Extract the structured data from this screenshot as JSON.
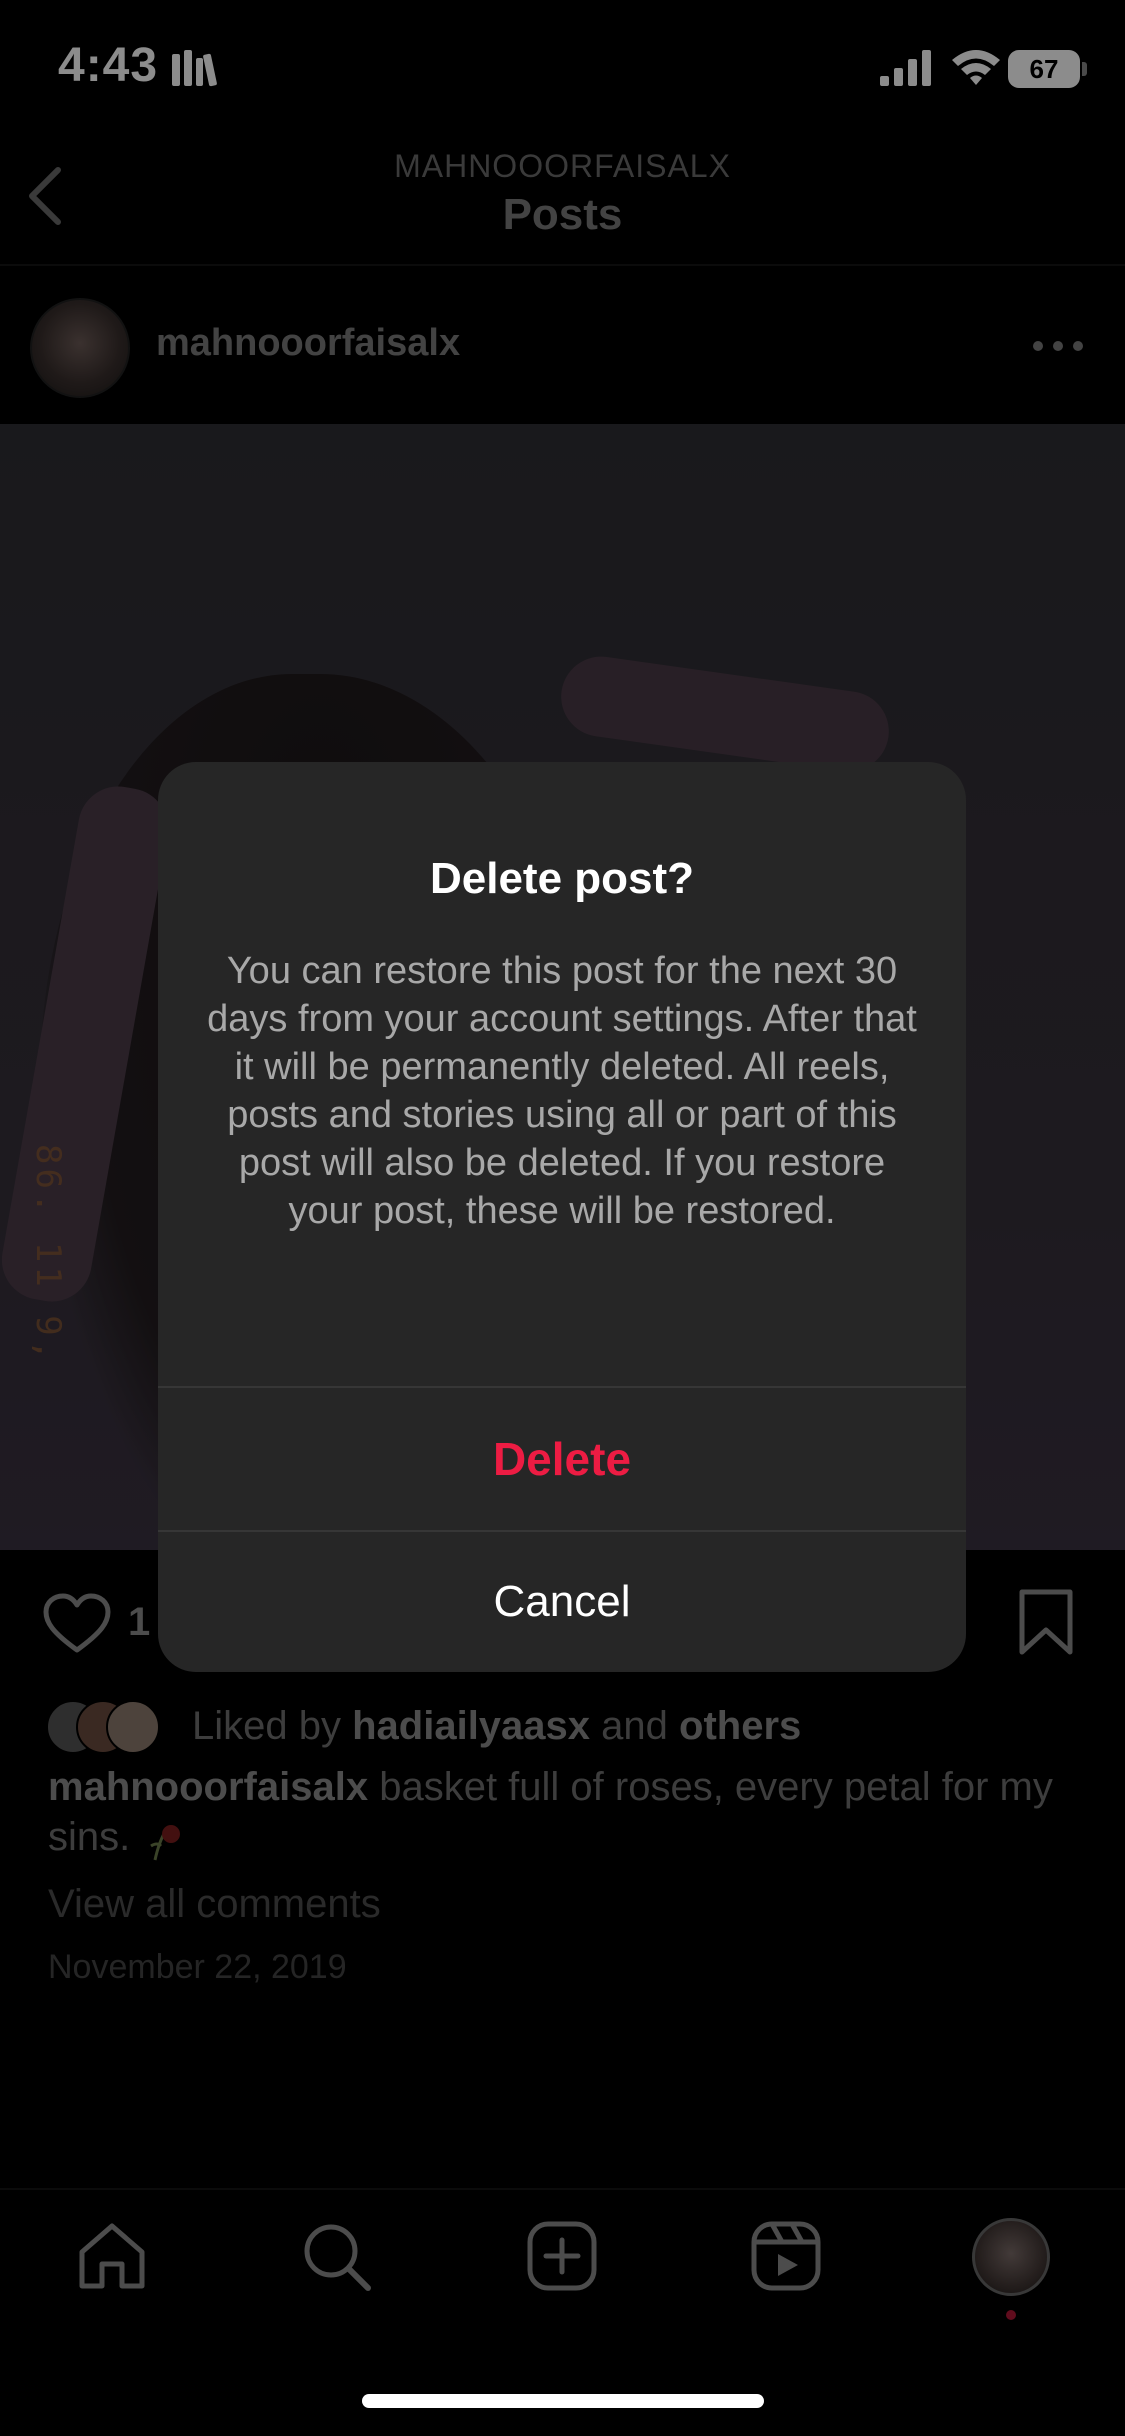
{
  "status_bar": {
    "time": "4:43",
    "battery": "67"
  },
  "header": {
    "subtitle": "MAHNOOORFAISALX",
    "title": "Posts"
  },
  "post": {
    "username": "mahnooorfaisalx",
    "film_stamp": "86. 11 9,",
    "like_count": "1",
    "liked_by_prefix": "Liked by",
    "liked_by_user": "hadiailyaasx",
    "liked_by_and": "and",
    "liked_by_others": "others",
    "caption_user": "mahnooorfaisalx",
    "caption_text": "basket full of roses, every petal for my sins.",
    "view_comments": "View all comments",
    "date": "November 22, 2019"
  },
  "dialog": {
    "title": "Delete post?",
    "body": "You can restore this post for the next 30 days from your account settings. After that it will be permanently deleted. All reels, posts and stories using all or part of this post will also be deleted. If you restore your post, these will be restored.",
    "delete_label": "Delete",
    "cancel_label": "Cancel"
  },
  "colors": {
    "accent_delete": "#ed1c43",
    "dialog_bg": "#262626"
  },
  "nav": {
    "items": [
      "home-icon",
      "search-icon",
      "create-icon",
      "reels-icon",
      "profile-avatar"
    ]
  }
}
